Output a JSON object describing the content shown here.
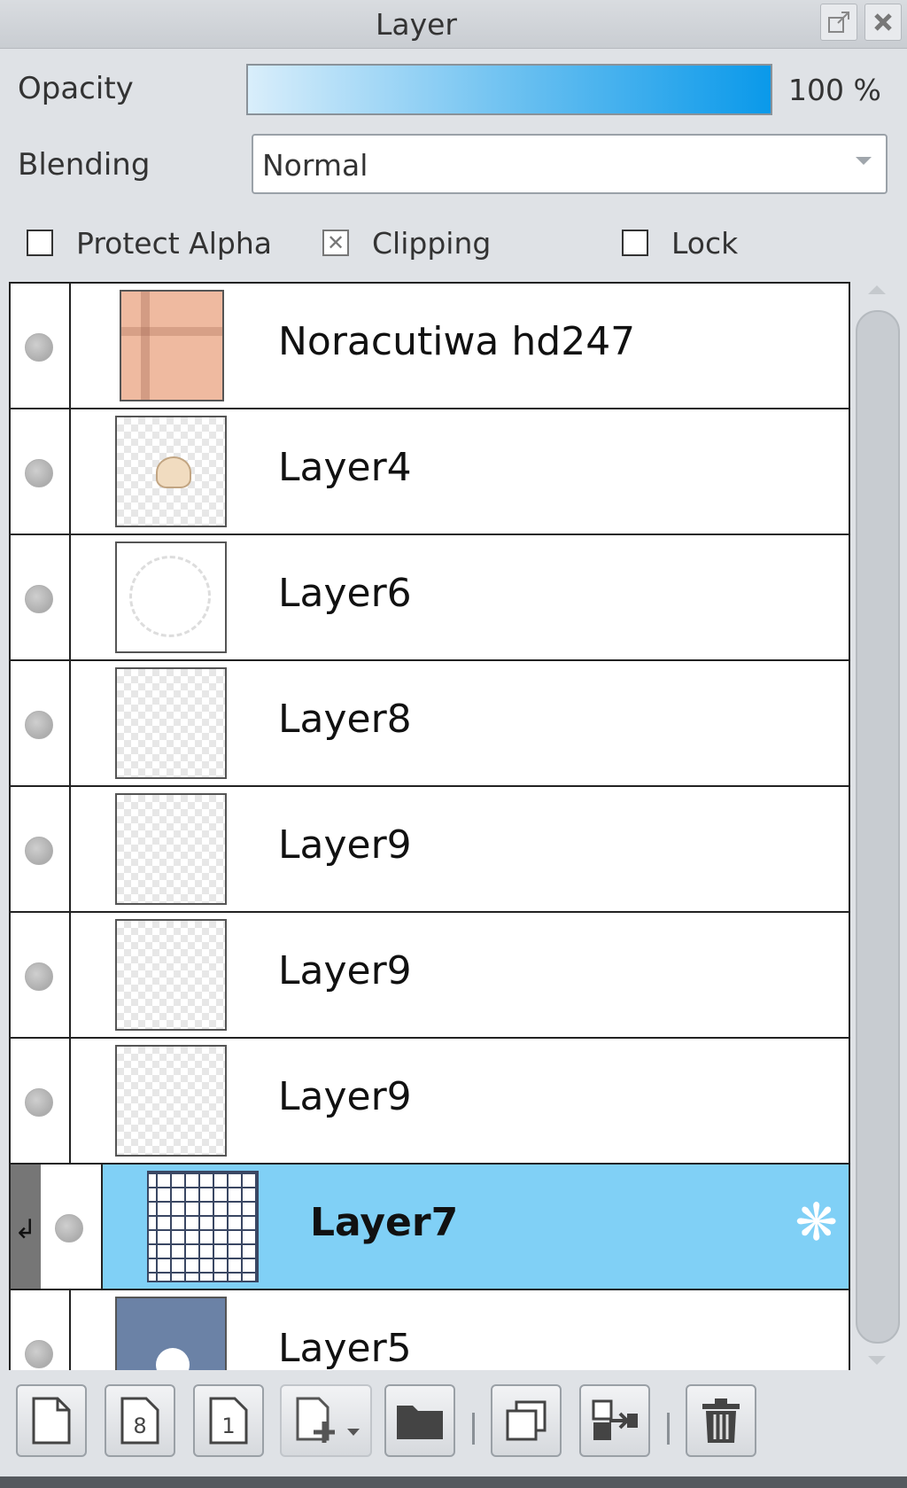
{
  "window": {
    "title": "Layer"
  },
  "opacity": {
    "label": "Opacity",
    "value": "100 %",
    "level": 1.0
  },
  "blending": {
    "label": "Blending",
    "value": "Normal"
  },
  "checks": {
    "protect_alpha": "Protect Alpha",
    "clipping": "Clipping",
    "lock": "Lock"
  },
  "layers": [
    {
      "name": "Noracutiwa hd247"
    },
    {
      "name": "Layer4"
    },
    {
      "name": "Layer6"
    },
    {
      "name": "Layer8"
    },
    {
      "name": "Layer9"
    },
    {
      "name": "Layer9"
    },
    {
      "name": "Layer9"
    },
    {
      "name": "Layer7",
      "selected": true,
      "clipped": true
    },
    {
      "name": "Layer5"
    }
  ],
  "colors": {
    "selected_row": "#80d0f6",
    "opacity_bar_end": "#0a99ea"
  },
  "toolbar_icons": [
    "new-layer-icon",
    "new-8bit-layer-icon",
    "new-1bit-layer-icon",
    "add-layer-menu-icon",
    "new-folder-icon",
    "duplicate-layer-icon",
    "merge-down-icon",
    "delete-layer-icon"
  ]
}
